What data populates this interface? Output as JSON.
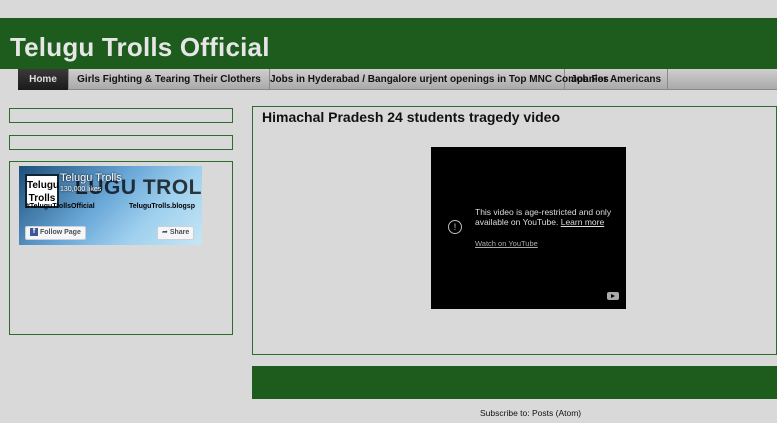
{
  "header": {
    "title": "Telugu Trolls Official"
  },
  "nav": {
    "items": [
      {
        "label": "Home"
      },
      {
        "label": "Girls Fighting & Tearing Their Clothers"
      },
      {
        "label": "Jobs in Hyderabad / Bangalore urjent openings in Top MNC Companies"
      },
      {
        "label": "Job For Americans"
      }
    ]
  },
  "facebook": {
    "logo_text": "Telugu Trolls",
    "page_title": "Telugu Trolls",
    "likes": "130,000 likes",
    "watermark": "LUGU TROLLS",
    "handle": "#TeluguTrollsOfficial",
    "blog": "TeluguTrolls.blogsp",
    "follow_label": "Follow Page",
    "share_label": "Share",
    "share_icon": "share-arrow-icon",
    "fb_icon": "facebook-icon"
  },
  "post": {
    "title": "Himachal Pradesh 24 students tragedy video",
    "video": {
      "message": "This video is age-restricted and only available on YouTube.",
      "learn_more": "Learn more",
      "watch_link": "Watch on YouTube",
      "warning_icon": "warning-icon",
      "logo_icon": "youtube-icon"
    }
  },
  "footer": {
    "subscribe_prefix": "Subscribe to:",
    "subscribe_link": "Posts (Atom)"
  },
  "colors": {
    "background": "#d9d9d9",
    "brand_green": "#1d5c1d",
    "nav_active": "#1a1a1a"
  }
}
